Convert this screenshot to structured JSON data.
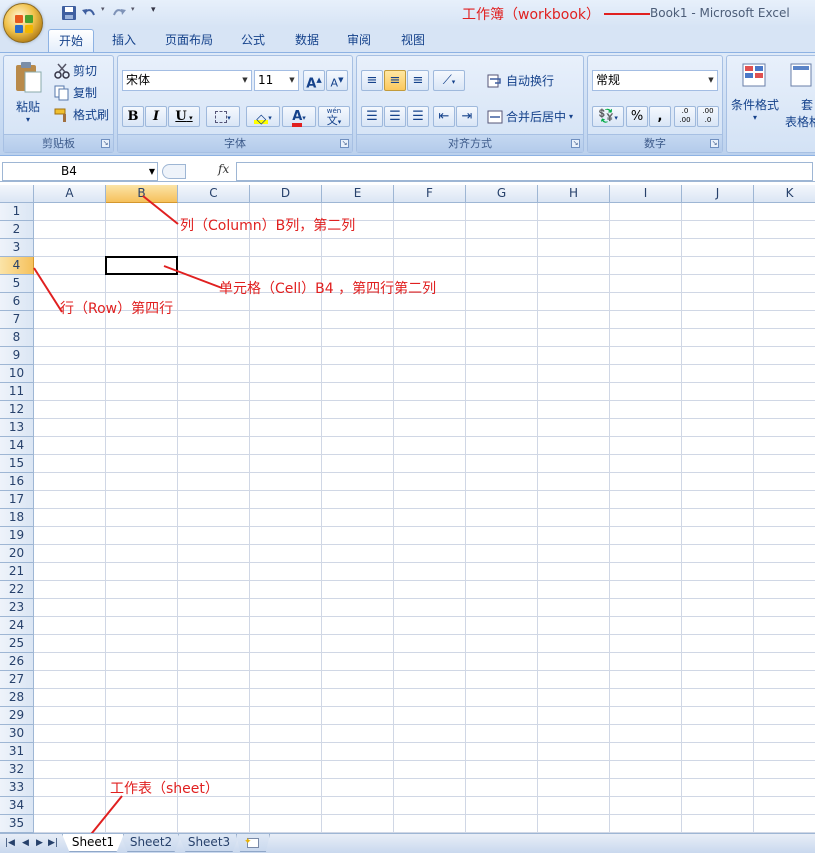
{
  "window": {
    "title": "Book1 - Microsoft Excel"
  },
  "annotations": {
    "workbook": "工作簿（workbook）",
    "column": "列（Column）B列，第二列",
    "cell": "单元格（Cell）B4 ，第四行第二列",
    "row": "行（Row）第四行",
    "sheet": "工作表（sheet）"
  },
  "qat": [
    "save-icon",
    "undo-icon",
    "redo-icon",
    "customize-icon"
  ],
  "tabs": [
    "开始",
    "插入",
    "页面布局",
    "公式",
    "数据",
    "审阅",
    "视图"
  ],
  "active_tab": "开始",
  "ribbon": {
    "clipboard": {
      "label": "剪贴板",
      "paste": "粘贴",
      "cut": "剪切",
      "copy": "复制",
      "format_painter": "格式刷"
    },
    "font": {
      "label": "字体",
      "family": "宋体",
      "size": "11",
      "bold": "B",
      "italic": "I",
      "underline": "U",
      "grow": "A",
      "shrink": "A",
      "color_letter": "A",
      "phonetic_top": "wén",
      "phonetic": "文"
    },
    "alignment": {
      "label": "对齐方式",
      "wrap": "自动换行",
      "merge": "合并后居中"
    },
    "number": {
      "label": "数字",
      "format": "常规",
      "percent": "%",
      "comma": ",",
      "inc": ".0 .00",
      "dec": ".00 .0"
    },
    "styles": {
      "conditional": "条件格式",
      "table_top": "套",
      "table_bottom": "表格格"
    }
  },
  "name_box": "B4",
  "fx": "fx",
  "columns": [
    "A",
    "B",
    "C",
    "D",
    "E",
    "F",
    "G",
    "H",
    "I",
    "J",
    "K"
  ],
  "rows": [
    "1",
    "2",
    "3",
    "4",
    "5",
    "6",
    "7",
    "8",
    "9",
    "10",
    "11",
    "12",
    "13",
    "14",
    "15",
    "16",
    "17",
    "18",
    "19",
    "20",
    "21",
    "22",
    "23",
    "24",
    "25",
    "26",
    "27",
    "28",
    "29",
    "30",
    "31",
    "32",
    "33",
    "34",
    "35"
  ],
  "selected": {
    "column": "B",
    "row": "4"
  },
  "sheets": [
    "Sheet1",
    "Sheet2",
    "Sheet3"
  ],
  "active_sheet": "Sheet1",
  "colors": {
    "annotation": "#e02020",
    "selection_header": "#f6c15c",
    "grid": "#d0d7e5"
  }
}
